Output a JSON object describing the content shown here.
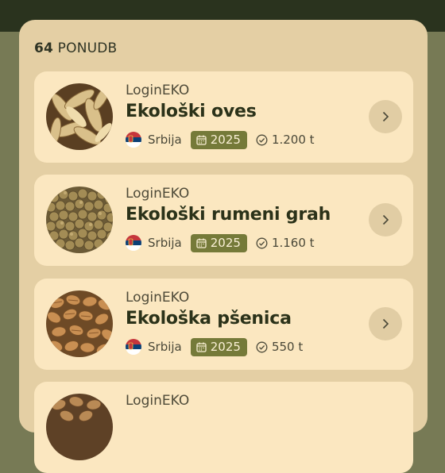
{
  "header": {
    "count_number": "64",
    "count_label": "PONUDB"
  },
  "colors": {
    "panel": "#e4cfa4",
    "card": "#fbe7c0",
    "badge": "#757a39",
    "dark": "#2a331e"
  },
  "offers": [
    {
      "seller": "LoginEKO",
      "title": "Ekološki oves",
      "country": "Srbija",
      "year": "2025",
      "quantity": "1.200 t",
      "image_icon": "oats-icon"
    },
    {
      "seller": "LoginEKO",
      "title": "Ekološki rumeni grah",
      "country": "Srbija",
      "year": "2025",
      "quantity": "1.160 t",
      "image_icon": "peas-icon"
    },
    {
      "seller": "LoginEKO",
      "title": "Ekološka pšenica",
      "country": "Srbija",
      "year": "2025",
      "quantity": "550 t",
      "image_icon": "wheat-icon"
    },
    {
      "seller": "LoginEKO",
      "title": "",
      "country": "",
      "year": "",
      "quantity": "",
      "image_icon": "grain-icon"
    }
  ]
}
